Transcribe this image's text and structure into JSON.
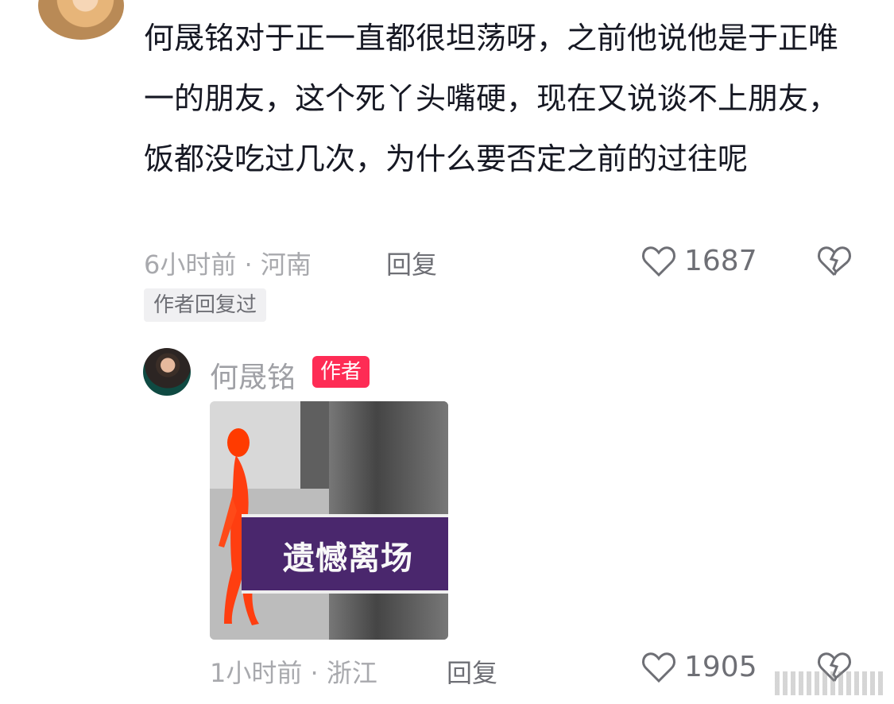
{
  "comment": {
    "text": "何晟铭对于正一直都很坦荡呀，之前他说他是于正唯一的朋友，这个死丫头嘴硬，现在又说谈不上朋友，饭都没吃过几次，为什么要否定之前的过往呢",
    "meta": "6小时前 · 河南",
    "reply_label": "回复",
    "likes": "1687",
    "author_replied_tag": "作者回复过"
  },
  "reply": {
    "author_name": "何晟铭",
    "author_badge": "作者",
    "image_caption": "遗憾离场",
    "meta": "1小时前 · 浙江",
    "reply_label": "回复",
    "likes": "1905"
  },
  "icons": {
    "like": "heart-icon",
    "dislike": "broken-heart-icon"
  },
  "colors": {
    "badge": "#fe2c55",
    "text": "#161823",
    "secondary": "#a8a9ad"
  }
}
